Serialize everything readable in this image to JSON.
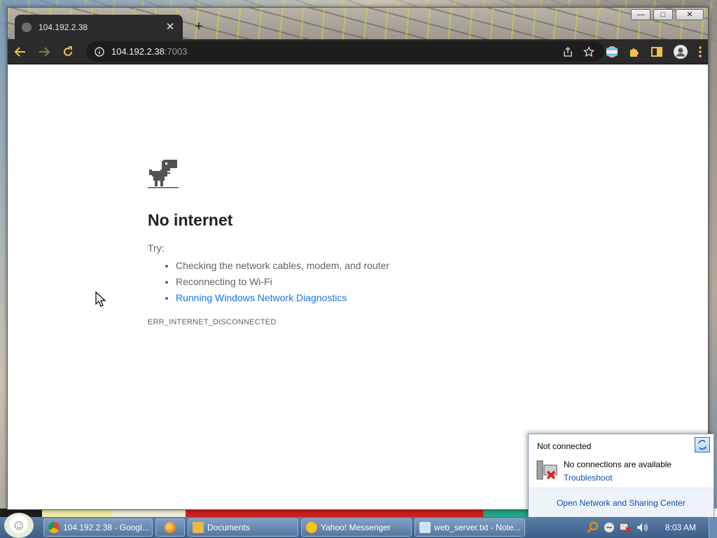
{
  "browser": {
    "tab_title": "104.192.2.38",
    "url_host": "104.192.2.38",
    "url_port": ":7003",
    "window_controls": [
      "minimize",
      "maximize",
      "close"
    ]
  },
  "page": {
    "heading": "No internet",
    "try_label": "Try:",
    "suggestions": [
      "Checking the network cables, modem, and router",
      "Reconnecting to Wi-Fi",
      "Running Windows Network Diagnostics"
    ],
    "error_code": "ERR_INTERNET_DISCONNECTED"
  },
  "network_popup": {
    "status": "Not connected",
    "message": "No connections are available",
    "troubleshoot": "Troubleshoot",
    "footer_link": "Open Network and Sharing Center"
  },
  "taskbar": {
    "buttons": [
      {
        "label": "104.192.2.38 - Googl...",
        "icon": "chrome-icon"
      },
      {
        "label": "",
        "icon": "firefox-icon"
      },
      {
        "label": "Documents",
        "icon": "folder-icon"
      },
      {
        "label": "Yahoo! Messenger",
        "icon": "messenger-icon"
      },
      {
        "label": "web_server.txt - Note...",
        "icon": "notepad-icon"
      }
    ],
    "clock": "8:03 AM"
  },
  "colors": {
    "link": "#1a73e8",
    "toolbar": "#2b2b2b",
    "taskbar": "#3b5f8a"
  }
}
